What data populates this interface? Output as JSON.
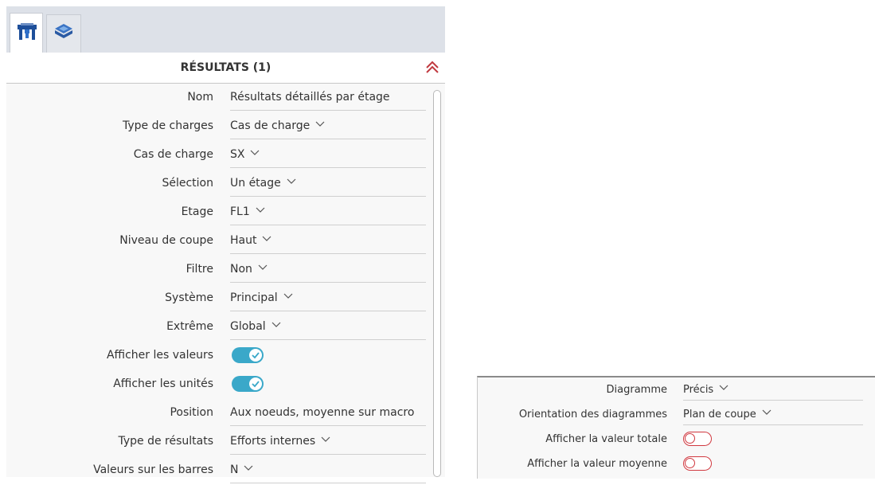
{
  "panel": {
    "title": "RÉSULTATS (1)",
    "rows": [
      {
        "label": "Nom",
        "value": "Résultats détaillés par étage",
        "kind": "text"
      },
      {
        "label": "Type de charges",
        "value": "Cas de charge",
        "kind": "select"
      },
      {
        "label": "Cas de charge",
        "value": "SX",
        "kind": "select"
      },
      {
        "label": "Sélection",
        "value": "Un étage",
        "kind": "select"
      },
      {
        "label": "Etage",
        "value": "FL1",
        "kind": "select"
      },
      {
        "label": "Niveau de coupe",
        "value": "Haut",
        "kind": "select"
      },
      {
        "label": "Filtre",
        "value": "Non",
        "kind": "select"
      },
      {
        "label": "Système",
        "value": "Principal",
        "kind": "select"
      },
      {
        "label": "Extrême",
        "value": "Global",
        "kind": "select"
      },
      {
        "label": "Afficher les valeurs",
        "value": true,
        "kind": "toggle"
      },
      {
        "label": "Afficher les unités",
        "value": true,
        "kind": "toggle"
      },
      {
        "label": "Position",
        "value": "Aux noeuds, moyenne sur macro",
        "kind": "text"
      },
      {
        "label": "Type de résultats",
        "value": "Efforts internes",
        "kind": "select"
      },
      {
        "label": "Valeurs sur les barres",
        "value": "N",
        "kind": "select"
      }
    ]
  },
  "panel2": {
    "rows": [
      {
        "label": "Diagramme",
        "value": "Précis",
        "kind": "select"
      },
      {
        "label": "Orientation des diagrammes",
        "value": "Plan de coupe",
        "kind": "select"
      },
      {
        "label": "Afficher la valeur totale",
        "value": false,
        "kind": "toggle"
      },
      {
        "label": "Afficher la valeur moyenne",
        "value": false,
        "kind": "toggle"
      }
    ]
  },
  "tabs": [
    {
      "icon": "structure-icon",
      "active": true
    },
    {
      "icon": "layers-icon",
      "active": false
    }
  ],
  "colors": {
    "toggle_on": "#3aa8c9",
    "toggle_off_border": "#d0383f",
    "collapse_icon": "#c0393f"
  }
}
